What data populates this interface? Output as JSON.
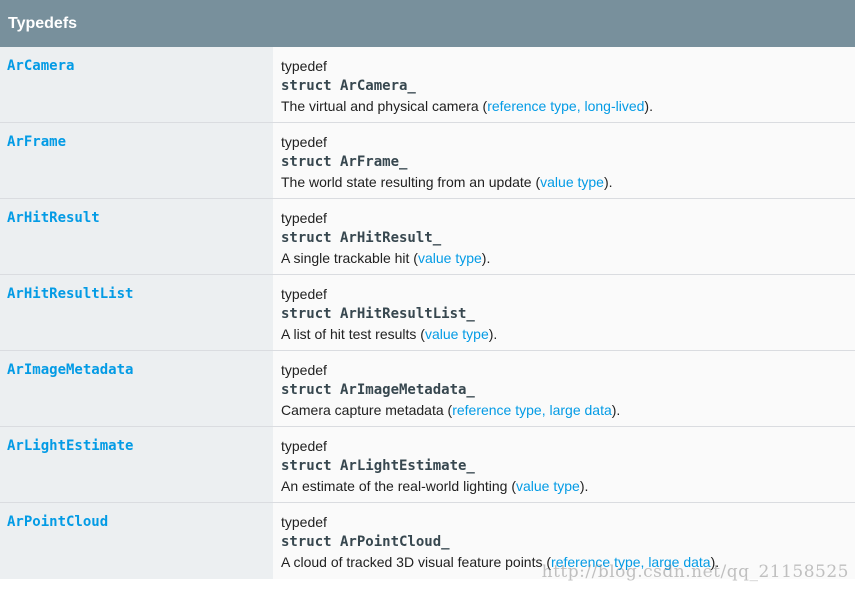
{
  "section": {
    "title": "Typedefs"
  },
  "rows": [
    {
      "name": "ArCamera",
      "keyword": "typedef",
      "struct": "struct ArCamera_",
      "desc_prefix": "The virtual and physical camera (",
      "desc_link": "reference type, long-lived",
      "desc_suffix": ")."
    },
    {
      "name": "ArFrame",
      "keyword": "typedef",
      "struct": "struct ArFrame_",
      "desc_prefix": "The world state resulting from an update (",
      "desc_link": "value type",
      "desc_suffix": ")."
    },
    {
      "name": "ArHitResult",
      "keyword": "typedef",
      "struct": "struct ArHitResult_",
      "desc_prefix": "A single trackable hit (",
      "desc_link": "value type",
      "desc_suffix": ")."
    },
    {
      "name": "ArHitResultList",
      "keyword": "typedef",
      "struct": "struct ArHitResultList_",
      "desc_prefix": "A list of hit test results (",
      "desc_link": "value type",
      "desc_suffix": ")."
    },
    {
      "name": "ArImageMetadata",
      "keyword": "typedef",
      "struct": "struct ArImageMetadata_",
      "desc_prefix": "Camera capture metadata (",
      "desc_link": "reference type, large data",
      "desc_suffix": ")."
    },
    {
      "name": "ArLightEstimate",
      "keyword": "typedef",
      "struct": "struct ArLightEstimate_",
      "desc_prefix": "An estimate of the real-world lighting (",
      "desc_link": "value type",
      "desc_suffix": ")."
    },
    {
      "name": "ArPointCloud",
      "keyword": "typedef",
      "struct": "struct ArPointCloud_",
      "desc_prefix": "A cloud of tracked 3D visual feature points (",
      "desc_link": "reference type, large data",
      "desc_suffix": ")."
    }
  ],
  "watermark": "http://blog.csdn.net/qq_21158525",
  "colors": {
    "header_bg": "#78909c",
    "name_cell_bg": "#eceff1",
    "link": "#039be5"
  }
}
